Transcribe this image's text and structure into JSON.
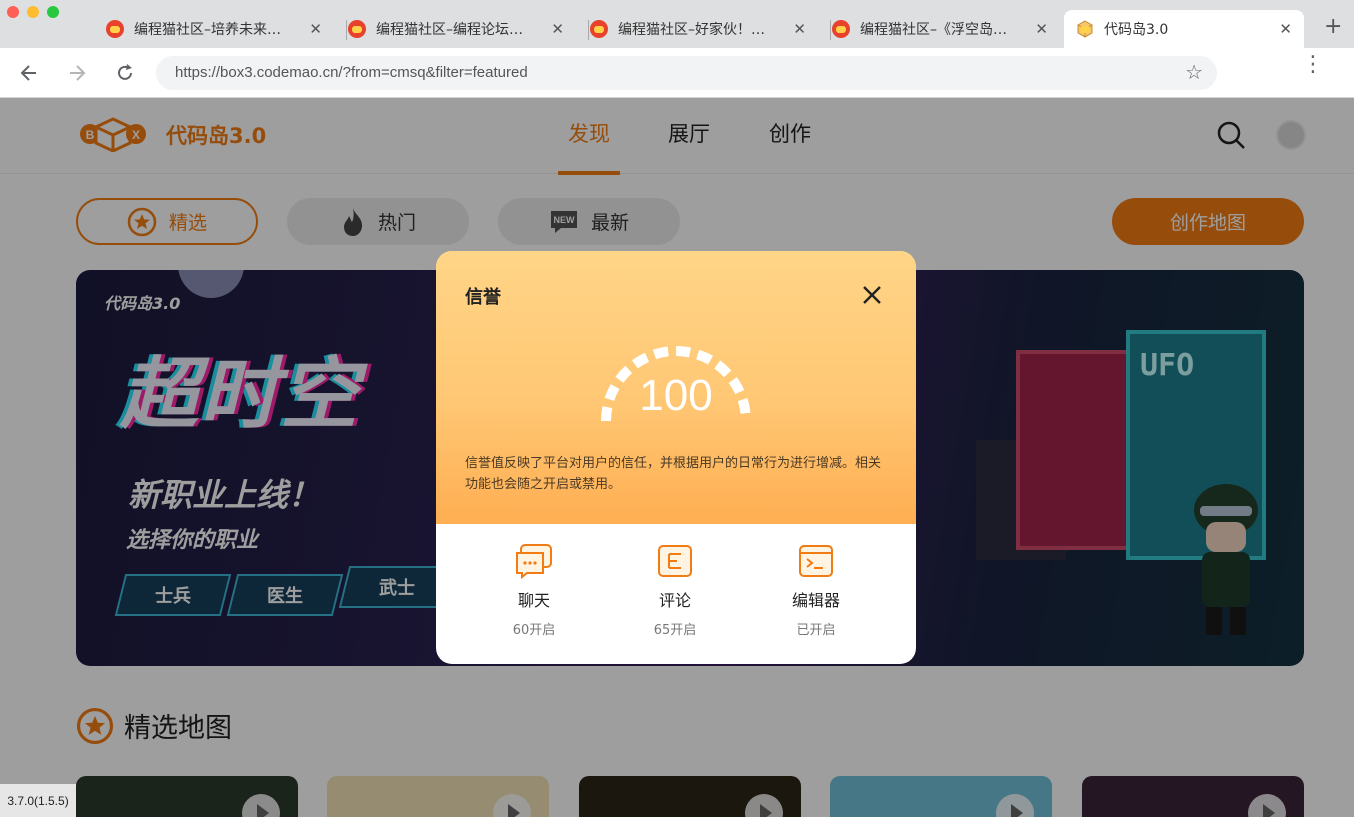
{
  "browser": {
    "tabs": [
      {
        "title": "编程猫社区–培养未来…",
        "active": false
      },
      {
        "title": "编程猫社区–编程论坛…",
        "active": false
      },
      {
        "title": "编程猫社区–好家伙！…",
        "active": false
      },
      {
        "title": "编程猫社区–《浮空岛…",
        "active": false
      },
      {
        "title": "代码岛3.0",
        "active": true
      }
    ],
    "url": "https://box3.codemao.cn/?from=cmsq&filter=featured"
  },
  "site": {
    "brand": "代码岛3.0",
    "nav": [
      "发现",
      "展厅",
      "创作"
    ],
    "active_nav": "发现"
  },
  "filters": {
    "featured": "精选",
    "hot": "热门",
    "latest": "最新",
    "new_badge": "NEW",
    "create_map": "创作地图"
  },
  "banner": {
    "tag": "代码岛3.0",
    "headline": "超时空",
    "subtitle": "新职业上线！",
    "subtitle2": "选择你的职业",
    "chips": [
      "士兵",
      "医生",
      "武士"
    ],
    "sign": "UFO"
  },
  "section": {
    "title": "精选地图"
  },
  "version": "3.7.0(1.5.5)",
  "modal": {
    "title": "信誉",
    "score": "100",
    "description": "信誉值反映了平台对用户的信任，并根据用户的日常行为进行增减。相关功能也会随之开启或禁用。",
    "permissions": [
      {
        "label": "聊天",
        "status": "60开启",
        "icon": "chat-icon"
      },
      {
        "label": "评论",
        "status": "65开启",
        "icon": "comment-icon"
      },
      {
        "label": "编辑器",
        "status": "已开启",
        "icon": "editor-icon"
      }
    ]
  },
  "colors": {
    "accent": "#f27c14",
    "modal_gradient_top": "#ffd587",
    "modal_gradient_bottom": "#ffae52"
  }
}
